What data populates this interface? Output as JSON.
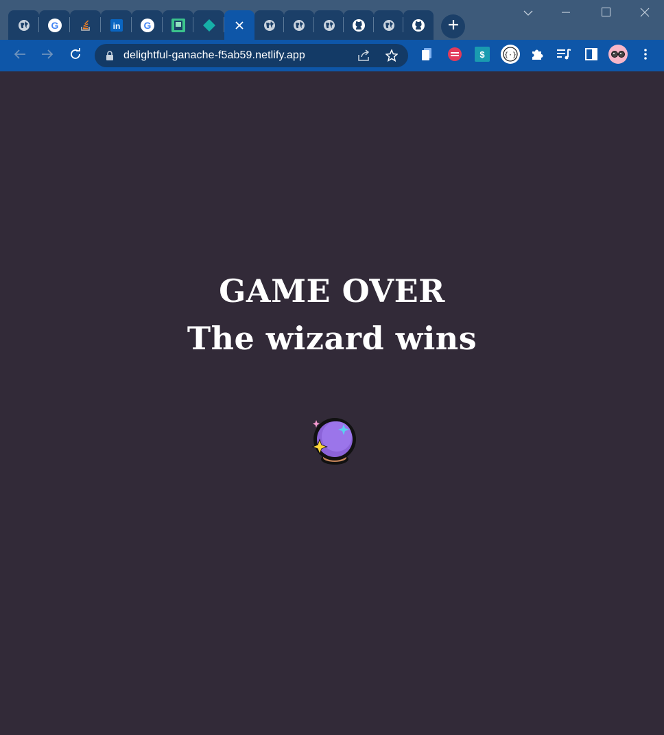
{
  "browser": {
    "tabs": [
      {
        "icon": "globe-icon",
        "active": false
      },
      {
        "icon": "google-icon",
        "active": false
      },
      {
        "icon": "stack-overflow-icon",
        "active": false
      },
      {
        "icon": "linkedin-icon",
        "active": false
      },
      {
        "icon": "google-icon",
        "active": false
      },
      {
        "icon": "green-app-icon",
        "active": false
      },
      {
        "icon": "teal-diamond-icon",
        "active": false
      },
      {
        "icon": "close-icon",
        "active": true
      },
      {
        "icon": "globe-icon",
        "active": false
      },
      {
        "icon": "globe-icon",
        "active": false
      },
      {
        "icon": "globe-icon",
        "active": false
      },
      {
        "icon": "github-icon",
        "active": false
      },
      {
        "icon": "globe-icon",
        "active": false
      },
      {
        "icon": "github-icon",
        "active": false
      }
    ],
    "url": "delightful-ganache-f5ab59.netlify.app",
    "colors": {
      "tabstrip": "#3d5a7a",
      "toolbar": "#0e56a8",
      "page_background": "#322a38"
    }
  },
  "game": {
    "title": "GAME OVER",
    "result": "The wizard wins",
    "icon": "crystal-ball-icon"
  }
}
